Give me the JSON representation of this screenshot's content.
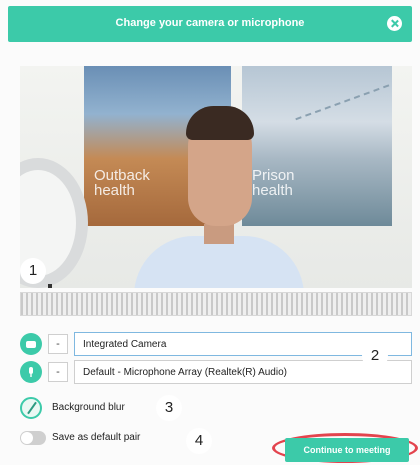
{
  "header": {
    "title": "Change your camera or microphone"
  },
  "preview": {
    "poster_left": "Outback\nhealth",
    "poster_right": "Prison\nhealth"
  },
  "callouts": [
    "1",
    "2",
    "3",
    "4"
  ],
  "devices": {
    "camera": {
      "toggle": "-",
      "value": "Integrated Camera"
    },
    "microphone": {
      "toggle": "-",
      "value": "Default - Microphone Array (Realtek(R) Audio)"
    }
  },
  "options": {
    "background_blur": "Background blur",
    "save_default": "Save as default pair"
  },
  "actions": {
    "continue": "Continue to meeting"
  },
  "colors": {
    "accent": "#3ccaa9",
    "highlight": "#e3444e"
  }
}
